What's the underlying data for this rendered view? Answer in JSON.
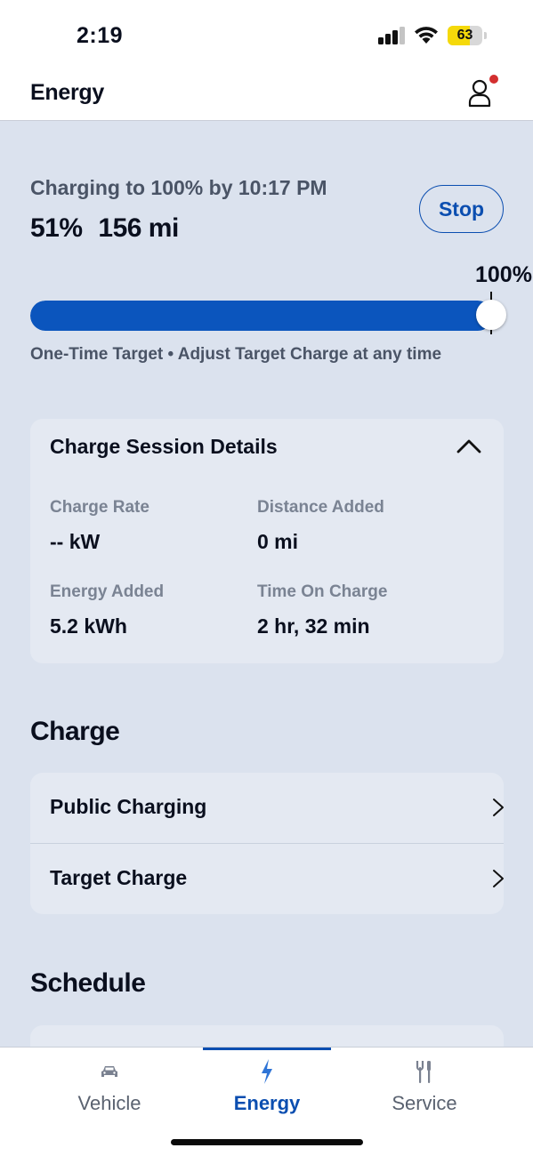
{
  "status_bar": {
    "time": "2:19",
    "battery_percent": "63",
    "battery_level": 0.63,
    "signal_bars": 3,
    "battery_color": "#f5d90a"
  },
  "header": {
    "title": "Energy",
    "profile_icon": "person-icon",
    "has_notification": true,
    "notification_color": "#d32f2f"
  },
  "charging": {
    "status_text": "Charging to 100% by 10:17 PM",
    "percent": "51%",
    "range": "156 mi",
    "stop_label": "Stop",
    "target_label": "100%",
    "target_level": 1.0,
    "caption": "One-Time Target • Adjust Target Charge at any time",
    "accent_color": "#0b55bd"
  },
  "session_details": {
    "title": "Charge Session Details",
    "expanded": true,
    "items": [
      {
        "label": "Charge Rate",
        "value": "-- kW"
      },
      {
        "label": "Distance Added",
        "value": "0 mi"
      },
      {
        "label": "Energy Added",
        "value": "5.2 kWh"
      },
      {
        "label": "Time On Charge",
        "value": "2 hr, 32 min"
      }
    ]
  },
  "charge_section": {
    "title": "Charge",
    "items": [
      {
        "label": "Public Charging"
      },
      {
        "label": "Target Charge"
      }
    ]
  },
  "schedule_section": {
    "title": "Schedule"
  },
  "bottom_nav": {
    "items": [
      {
        "label": "Vehicle",
        "icon": "car-icon",
        "active": false
      },
      {
        "label": "Energy",
        "icon": "lightning-icon",
        "active": true
      },
      {
        "label": "Service",
        "icon": "tools-icon",
        "active": false
      }
    ]
  }
}
